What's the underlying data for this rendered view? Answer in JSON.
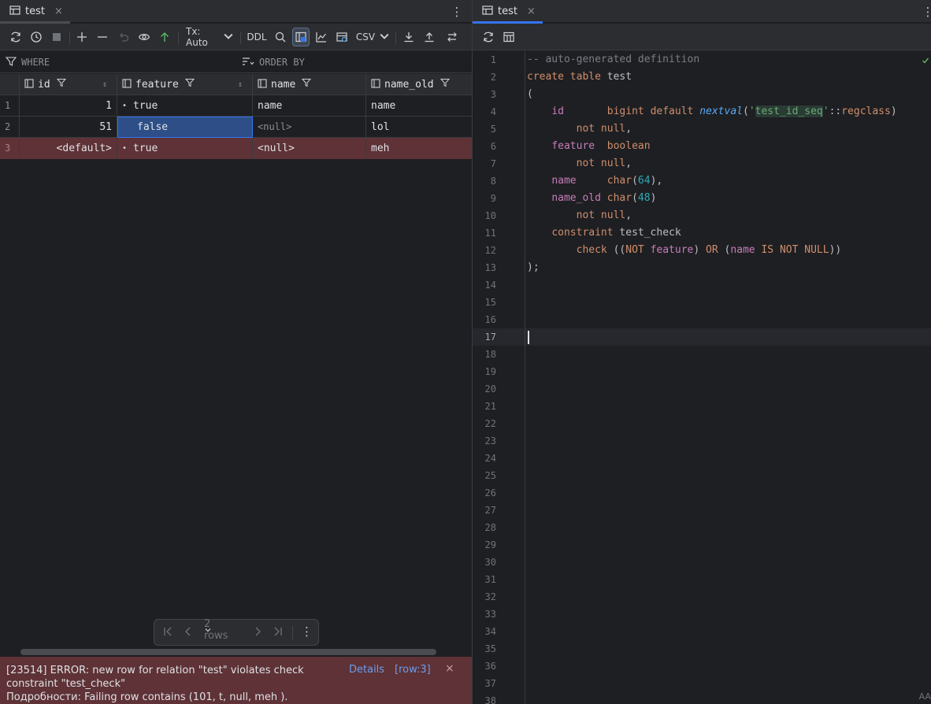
{
  "left_tab": {
    "title": "test",
    "close": "×",
    "kebab": "⋮"
  },
  "toolbar": {
    "tx_label": "Tx: Auto",
    "ddl_label": "DDL",
    "csv_label": "CSV"
  },
  "filter": {
    "where_label": "WHERE",
    "order_label": "ORDER BY"
  },
  "grid": {
    "columns": [
      "id",
      "feature",
      "name",
      "name_old"
    ],
    "rows": [
      {
        "num": "1",
        "id": "1",
        "feature": "true",
        "name": "name",
        "name_old": "name"
      },
      {
        "num": "2",
        "id": "51",
        "feature": "false",
        "name": "<null>",
        "name_old": "lol"
      },
      {
        "num": "3",
        "id": "<default>",
        "feature": "true",
        "name": "<null>",
        "name_old": "meh"
      }
    ]
  },
  "pager": {
    "rows_label": "2 rows"
  },
  "error": {
    "line1": "[23514] ERROR: new row for relation \"test\" violates check",
    "line2": "constraint \"test_check\"",
    "line3": "Подробности: Failing row contains (101, t, null, meh ).",
    "details": "Details",
    "row_ref": "[row:3]",
    "close": "×"
  },
  "right_tab": {
    "title": "test",
    "close": "×",
    "kebab": "⋮"
  },
  "editor": {
    "line_numbers": [
      "1",
      "2",
      "3",
      "4",
      "5",
      "6",
      "7",
      "8",
      "9",
      "10",
      "11",
      "12",
      "13",
      "14",
      "15",
      "16",
      "17",
      "18",
      "19",
      "20",
      "21",
      "22",
      "23",
      "24",
      "25",
      "26",
      "27",
      "28",
      "29",
      "30",
      "31",
      "32",
      "33",
      "34",
      "35",
      "36",
      "37",
      "38"
    ],
    "current_line": "17",
    "comment": "-- auto-generated definition",
    "kw_create": "create",
    "kw_table": "table",
    "tbl_name": "test",
    "paren_open": "(",
    "col_id": "id",
    "t_bigint": "bigint",
    "kw_default": "default",
    "fn_nextval": "nextval",
    "str_seq": "test_id_seq",
    "cast": "::",
    "t_regclass": "regclass",
    "kw_not_null": "not null",
    "col_feature": "feature",
    "t_boolean": "boolean",
    "col_name": "name",
    "t_char": "char",
    "n64": "64",
    "col_name_old": "name_old",
    "n48": "48",
    "kw_constraint": "constraint",
    "constraint_name": "test_check",
    "kw_check": "check",
    "kw_not": "NOT",
    "kw_or": "OR",
    "kw_is_not_null": "IS NOT NULL",
    "close_stmt": ");",
    "aa_label": "AA"
  }
}
